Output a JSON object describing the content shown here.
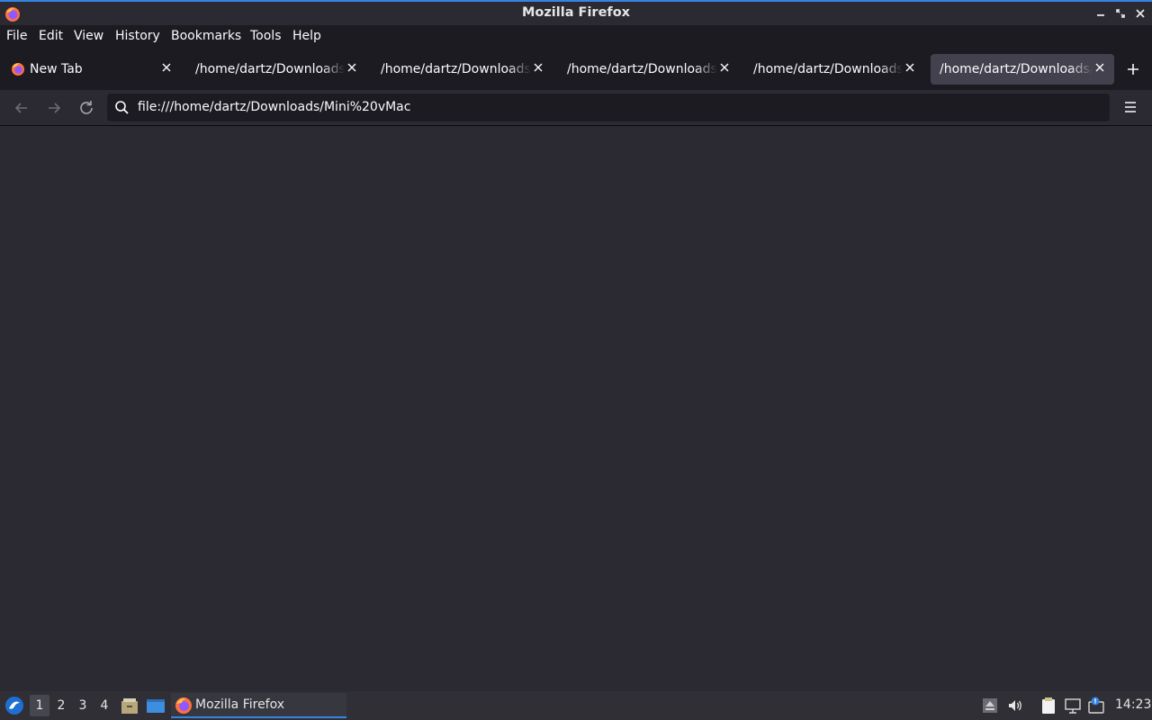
{
  "window": {
    "title": "Mozilla Firefox"
  },
  "menubar": {
    "items": [
      {
        "label": "File"
      },
      {
        "label": "Edit"
      },
      {
        "label": "View"
      },
      {
        "label": "History"
      },
      {
        "label": "Bookmarks"
      },
      {
        "label": "Tools"
      },
      {
        "label": "Help"
      }
    ]
  },
  "tabs": [
    {
      "label": "New Tab",
      "active": false
    },
    {
      "label": "/home/dartz/Downloads/Mini vMac",
      "active": false
    },
    {
      "label": "/home/dartz/Downloads/Mini vMac",
      "active": false
    },
    {
      "label": "/home/dartz/Downloads/Mini vMac",
      "active": false
    },
    {
      "label": "/home/dartz/Downloads/Mini vMac",
      "active": false
    },
    {
      "label": "/home/dartz/Downloads/Mini vMac",
      "active": true
    }
  ],
  "navbar": {
    "url": "file:///home/dartz/Downloads/Mini%20vMac"
  },
  "taskbar": {
    "workspaces": [
      "1",
      "2",
      "3",
      "4"
    ],
    "active_workspace": "1",
    "task_label": "Mozilla Firefox",
    "clock": "14:23"
  },
  "icons": {
    "app": "firefox-icon",
    "back": "back-arrow-icon",
    "forward": "forward-arrow-icon",
    "reload": "reload-icon",
    "search": "search-icon",
    "menu": "hamburger-menu-icon"
  },
  "colors": {
    "accent": "#3584e4",
    "toolbar": "#2b2a33",
    "tabbar": "#1c1b22",
    "active_tab": "#42414d"
  }
}
